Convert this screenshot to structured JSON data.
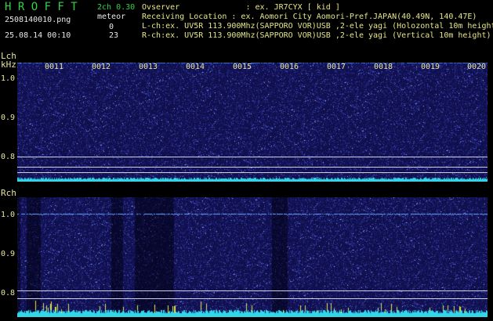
{
  "header": {
    "app_title": "H R O F F T",
    "filename": "2508140010.png",
    "datetime": "25.08.14 00:10",
    "channel_info": "2ch 0.30",
    "meteor_label": "meteor",
    "lch_count": "0",
    "rch_count": "23",
    "observer_line": "Ovserver              : ex. JR7CYX [ kid ]",
    "location_line": "Receiving Location : ex. Aomori City Aomori-Pref.JAPAN(40.49N, 140.47E)",
    "lch_line": "L-ch:ex. UV5R 113.900Mhz(SAPPORO VOR)USB ,2-ele yagi (Holozontal 10m height)",
    "rch_line": "R-ch:ex. UV5R 113.900Mhz(SAPPORO VOR)USB ,2-ele yagi (Vertical 10m height)"
  },
  "lch_panel": {
    "label": "Lch",
    "unit": "kHz",
    "ticks": [
      "1.0",
      "0.9",
      "0.8"
    ]
  },
  "rch_panel": {
    "label": "Rch",
    "ticks": [
      "1.0",
      "0.9",
      "0.8"
    ]
  },
  "minute_labels": [
    "0011",
    "0012",
    "0013",
    "0014",
    "0015",
    "0016",
    "0017",
    "0018",
    "0019",
    "0020"
  ],
  "colors": {
    "background": "#000000",
    "spectrogram_base": "#10104e",
    "carrier": "#6fa8ff",
    "baseline_cyan": "#33d5e8",
    "meteor_yellow": "#e8e84a",
    "header_green": "#33d14a"
  }
}
